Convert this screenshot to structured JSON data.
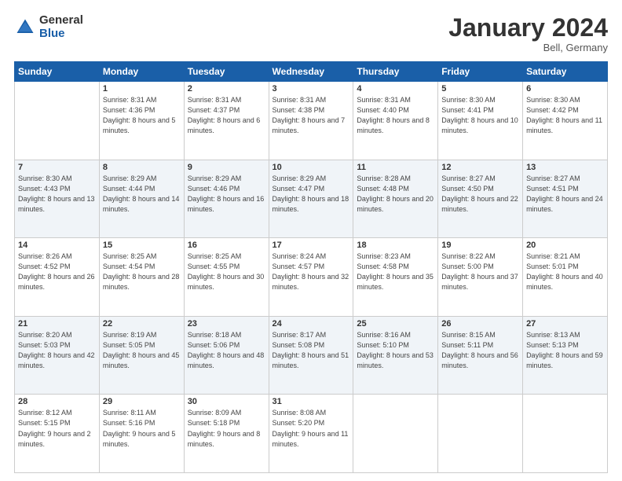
{
  "logo": {
    "general": "General",
    "blue": "Blue"
  },
  "title": "January 2024",
  "location": "Bell, Germany",
  "days_of_week": [
    "Sunday",
    "Monday",
    "Tuesday",
    "Wednesday",
    "Thursday",
    "Friday",
    "Saturday"
  ],
  "weeks": [
    [
      {
        "day": "",
        "sunrise": "",
        "sunset": "",
        "daylight": ""
      },
      {
        "day": "1",
        "sunrise": "Sunrise: 8:31 AM",
        "sunset": "Sunset: 4:36 PM",
        "daylight": "Daylight: 8 hours and 5 minutes."
      },
      {
        "day": "2",
        "sunrise": "Sunrise: 8:31 AM",
        "sunset": "Sunset: 4:37 PM",
        "daylight": "Daylight: 8 hours and 6 minutes."
      },
      {
        "day": "3",
        "sunrise": "Sunrise: 8:31 AM",
        "sunset": "Sunset: 4:38 PM",
        "daylight": "Daylight: 8 hours and 7 minutes."
      },
      {
        "day": "4",
        "sunrise": "Sunrise: 8:31 AM",
        "sunset": "Sunset: 4:40 PM",
        "daylight": "Daylight: 8 hours and 8 minutes."
      },
      {
        "day": "5",
        "sunrise": "Sunrise: 8:30 AM",
        "sunset": "Sunset: 4:41 PM",
        "daylight": "Daylight: 8 hours and 10 minutes."
      },
      {
        "day": "6",
        "sunrise": "Sunrise: 8:30 AM",
        "sunset": "Sunset: 4:42 PM",
        "daylight": "Daylight: 8 hours and 11 minutes."
      }
    ],
    [
      {
        "day": "7",
        "sunrise": "Sunrise: 8:30 AM",
        "sunset": "Sunset: 4:43 PM",
        "daylight": "Daylight: 8 hours and 13 minutes."
      },
      {
        "day": "8",
        "sunrise": "Sunrise: 8:29 AM",
        "sunset": "Sunset: 4:44 PM",
        "daylight": "Daylight: 8 hours and 14 minutes."
      },
      {
        "day": "9",
        "sunrise": "Sunrise: 8:29 AM",
        "sunset": "Sunset: 4:46 PM",
        "daylight": "Daylight: 8 hours and 16 minutes."
      },
      {
        "day": "10",
        "sunrise": "Sunrise: 8:29 AM",
        "sunset": "Sunset: 4:47 PM",
        "daylight": "Daylight: 8 hours and 18 minutes."
      },
      {
        "day": "11",
        "sunrise": "Sunrise: 8:28 AM",
        "sunset": "Sunset: 4:48 PM",
        "daylight": "Daylight: 8 hours and 20 minutes."
      },
      {
        "day": "12",
        "sunrise": "Sunrise: 8:27 AM",
        "sunset": "Sunset: 4:50 PM",
        "daylight": "Daylight: 8 hours and 22 minutes."
      },
      {
        "day": "13",
        "sunrise": "Sunrise: 8:27 AM",
        "sunset": "Sunset: 4:51 PM",
        "daylight": "Daylight: 8 hours and 24 minutes."
      }
    ],
    [
      {
        "day": "14",
        "sunrise": "Sunrise: 8:26 AM",
        "sunset": "Sunset: 4:52 PM",
        "daylight": "Daylight: 8 hours and 26 minutes."
      },
      {
        "day": "15",
        "sunrise": "Sunrise: 8:25 AM",
        "sunset": "Sunset: 4:54 PM",
        "daylight": "Daylight: 8 hours and 28 minutes."
      },
      {
        "day": "16",
        "sunrise": "Sunrise: 8:25 AM",
        "sunset": "Sunset: 4:55 PM",
        "daylight": "Daylight: 8 hours and 30 minutes."
      },
      {
        "day": "17",
        "sunrise": "Sunrise: 8:24 AM",
        "sunset": "Sunset: 4:57 PM",
        "daylight": "Daylight: 8 hours and 32 minutes."
      },
      {
        "day": "18",
        "sunrise": "Sunrise: 8:23 AM",
        "sunset": "Sunset: 4:58 PM",
        "daylight": "Daylight: 8 hours and 35 minutes."
      },
      {
        "day": "19",
        "sunrise": "Sunrise: 8:22 AM",
        "sunset": "Sunset: 5:00 PM",
        "daylight": "Daylight: 8 hours and 37 minutes."
      },
      {
        "day": "20",
        "sunrise": "Sunrise: 8:21 AM",
        "sunset": "Sunset: 5:01 PM",
        "daylight": "Daylight: 8 hours and 40 minutes."
      }
    ],
    [
      {
        "day": "21",
        "sunrise": "Sunrise: 8:20 AM",
        "sunset": "Sunset: 5:03 PM",
        "daylight": "Daylight: 8 hours and 42 minutes."
      },
      {
        "day": "22",
        "sunrise": "Sunrise: 8:19 AM",
        "sunset": "Sunset: 5:05 PM",
        "daylight": "Daylight: 8 hours and 45 minutes."
      },
      {
        "day": "23",
        "sunrise": "Sunrise: 8:18 AM",
        "sunset": "Sunset: 5:06 PM",
        "daylight": "Daylight: 8 hours and 48 minutes."
      },
      {
        "day": "24",
        "sunrise": "Sunrise: 8:17 AM",
        "sunset": "Sunset: 5:08 PM",
        "daylight": "Daylight: 8 hours and 51 minutes."
      },
      {
        "day": "25",
        "sunrise": "Sunrise: 8:16 AM",
        "sunset": "Sunset: 5:10 PM",
        "daylight": "Daylight: 8 hours and 53 minutes."
      },
      {
        "day": "26",
        "sunrise": "Sunrise: 8:15 AM",
        "sunset": "Sunset: 5:11 PM",
        "daylight": "Daylight: 8 hours and 56 minutes."
      },
      {
        "day": "27",
        "sunrise": "Sunrise: 8:13 AM",
        "sunset": "Sunset: 5:13 PM",
        "daylight": "Daylight: 8 hours and 59 minutes."
      }
    ],
    [
      {
        "day": "28",
        "sunrise": "Sunrise: 8:12 AM",
        "sunset": "Sunset: 5:15 PM",
        "daylight": "Daylight: 9 hours and 2 minutes."
      },
      {
        "day": "29",
        "sunrise": "Sunrise: 8:11 AM",
        "sunset": "Sunset: 5:16 PM",
        "daylight": "Daylight: 9 hours and 5 minutes."
      },
      {
        "day": "30",
        "sunrise": "Sunrise: 8:09 AM",
        "sunset": "Sunset: 5:18 PM",
        "daylight": "Daylight: 9 hours and 8 minutes."
      },
      {
        "day": "31",
        "sunrise": "Sunrise: 8:08 AM",
        "sunset": "Sunset: 5:20 PM",
        "daylight": "Daylight: 9 hours and 11 minutes."
      },
      {
        "day": "",
        "sunrise": "",
        "sunset": "",
        "daylight": ""
      },
      {
        "day": "",
        "sunrise": "",
        "sunset": "",
        "daylight": ""
      },
      {
        "day": "",
        "sunrise": "",
        "sunset": "",
        "daylight": ""
      }
    ]
  ]
}
